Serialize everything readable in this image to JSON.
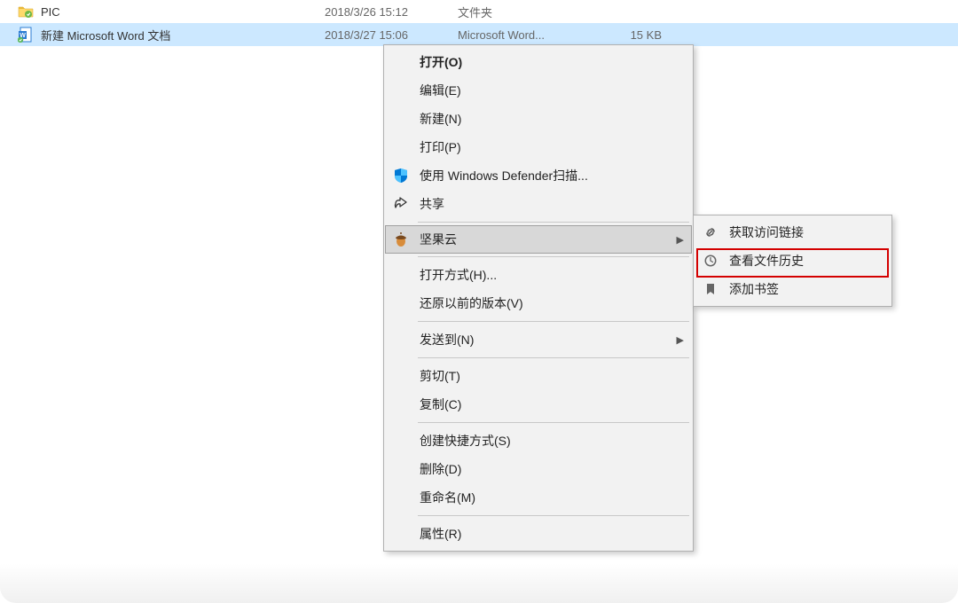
{
  "files": [
    {
      "name": "PIC",
      "date": "2018/3/26 15:12",
      "type": "文件夹",
      "size": ""
    },
    {
      "name": "新建 Microsoft Word 文档",
      "date": "2018/3/27 15:06",
      "type": "Microsoft Word...",
      "size": "15 KB"
    }
  ],
  "menu": {
    "open": "打开(O)",
    "edit": "编辑(E)",
    "new": "新建(N)",
    "print": "打印(P)",
    "defender": "使用 Windows Defender扫描...",
    "share": "共享",
    "jianguoyun": "坚果云",
    "open_with": "打开方式(H)...",
    "restore": "还原以前的版本(V)",
    "send_to": "发送到(N)",
    "cut": "剪切(T)",
    "copy": "复制(C)",
    "shortcut": "创建快捷方式(S)",
    "delete": "删除(D)",
    "rename": "重命名(M)",
    "properties": "属性(R)"
  },
  "submenu": {
    "get_link": "获取访问链接",
    "view_history": "查看文件历史",
    "add_bookmark": "添加书签"
  }
}
